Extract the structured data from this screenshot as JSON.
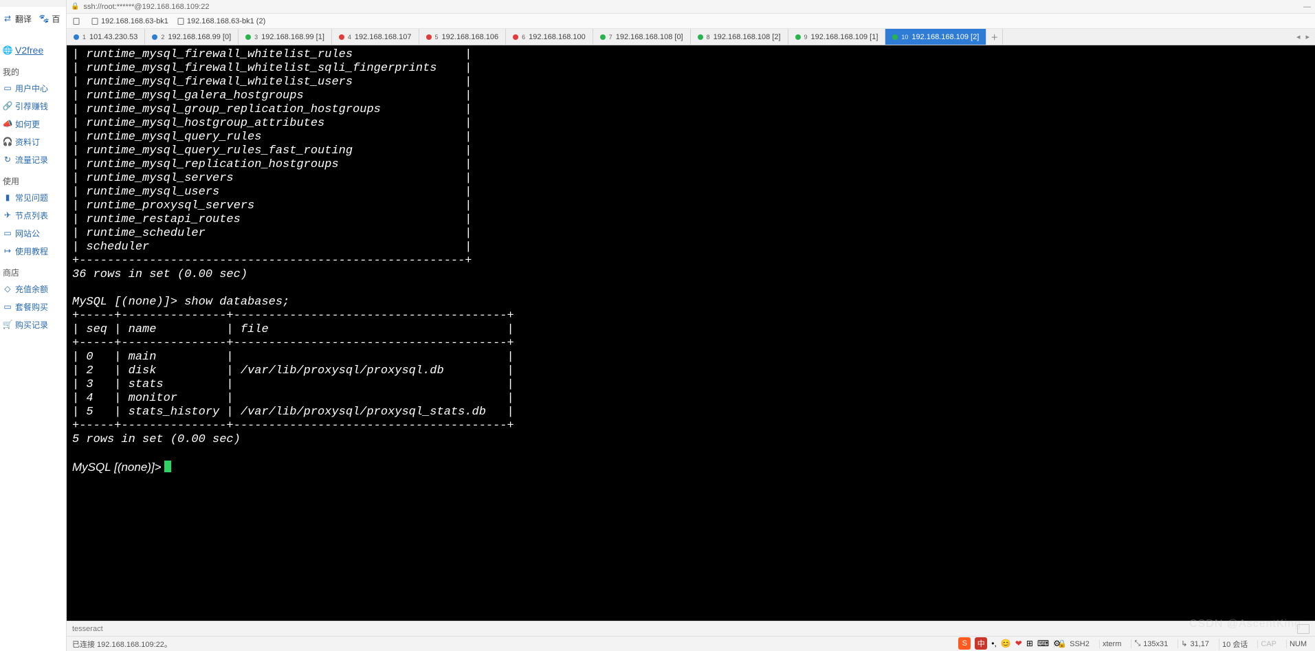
{
  "browser": {
    "translate": "翻译",
    "baidu": "百",
    "logo": "V2free",
    "sections": [
      {
        "title": "我的",
        "items": [
          {
            "icon": "user-icon",
            "label": "用户中心"
          },
          {
            "icon": "link-icon",
            "label": "引荐赚钱"
          },
          {
            "icon": "how-icon",
            "label": "如何更"
          },
          {
            "icon": "sub-icon",
            "label": "资料订"
          },
          {
            "icon": "traffic-icon",
            "label": "流量记录"
          }
        ]
      },
      {
        "title": "使用",
        "items": [
          {
            "icon": "faq-icon",
            "label": "常见问题"
          },
          {
            "icon": "node-icon",
            "label": "节点列表"
          },
          {
            "icon": "ann-icon",
            "label": "网站公"
          },
          {
            "icon": "tut-icon",
            "label": "使用教程"
          }
        ]
      },
      {
        "title": "商店",
        "items": [
          {
            "icon": "topup-icon",
            "label": "充值余额"
          },
          {
            "icon": "plan-icon",
            "label": "套餐购买"
          },
          {
            "icon": "buy-icon",
            "label": "购买记录"
          }
        ]
      }
    ]
  },
  "titlebar": {
    "text": "ssh://root:******@192.168.168.109:22"
  },
  "bookmarks": [
    {
      "icon": "bookmark-icon",
      "label": ""
    },
    {
      "icon": "file-icon",
      "label": "192.168.168.63-bk1"
    },
    {
      "icon": "file-icon",
      "label": "192.168.168.63-bk1 (2)"
    }
  ],
  "tabs": [
    {
      "dot": "blue",
      "num": "1",
      "label": "101.43.230.53"
    },
    {
      "dot": "blue",
      "num": "2",
      "label": "192.168.168.99 [0]"
    },
    {
      "dot": "green",
      "num": "3",
      "label": "192.168.168.99 [1]"
    },
    {
      "dot": "red",
      "num": "4",
      "label": "192.168.168.107"
    },
    {
      "dot": "red",
      "num": "5",
      "label": "192.168.168.106"
    },
    {
      "dot": "red",
      "num": "6",
      "label": "192.168.168.100"
    },
    {
      "dot": "green",
      "num": "7",
      "label": "192.168.168.108 [0]"
    },
    {
      "dot": "green",
      "num": "8",
      "label": "192.168.168.108 [2]"
    },
    {
      "dot": "green",
      "num": "9",
      "label": "192.168.168.109 [1]"
    },
    {
      "dot": "green",
      "num": "10",
      "label": "192.168.168.109 [2]",
      "active": true
    }
  ],
  "terminal": {
    "tables": [
      "runtime_mysql_firewall_whitelist_rules",
      "runtime_mysql_firewall_whitelist_sqli_fingerprints",
      "runtime_mysql_firewall_whitelist_users",
      "runtime_mysql_galera_hostgroups",
      "runtime_mysql_group_replication_hostgroups",
      "runtime_mysql_hostgroup_attributes",
      "runtime_mysql_query_rules",
      "runtime_mysql_query_rules_fast_routing",
      "runtime_mysql_replication_hostgroups",
      "runtime_mysql_servers",
      "runtime_mysql_users",
      "runtime_proxysql_servers",
      "runtime_restapi_routes",
      "runtime_scheduler",
      "scheduler"
    ],
    "rows1": "36 rows in set (0.00 sec)",
    "prompt": "MySQL [(none)]>",
    "cmd": "show databases;",
    "db_header": [
      "seq",
      "name",
      "file"
    ],
    "databases": [
      {
        "seq": "0",
        "name": "main",
        "file": ""
      },
      {
        "seq": "2",
        "name": "disk",
        "file": "/var/lib/proxysql/proxysql.db"
      },
      {
        "seq": "3",
        "name": "stats",
        "file": ""
      },
      {
        "seq": "4",
        "name": "monitor",
        "file": ""
      },
      {
        "seq": "5",
        "name": "stats_history",
        "file": "/var/lib/proxysql/proxysql_stats.db"
      }
    ],
    "rows2": "5 rows in set (0.00 sec)"
  },
  "hostfoot": {
    "text": "tesseract"
  },
  "status": {
    "left": "已连接 192.168.168.109:22。",
    "ssh": "SSH2",
    "term": "xterm",
    "size": "135x31",
    "cursor": "31,17",
    "sessions": "10 会话",
    "caps": "CAP",
    "num": "NUM"
  },
  "watermark": "CSDN @AscentKing",
  "tray": {
    "zh": "中",
    "punct": "•,",
    "face": "😊",
    "grid": "⊞"
  }
}
